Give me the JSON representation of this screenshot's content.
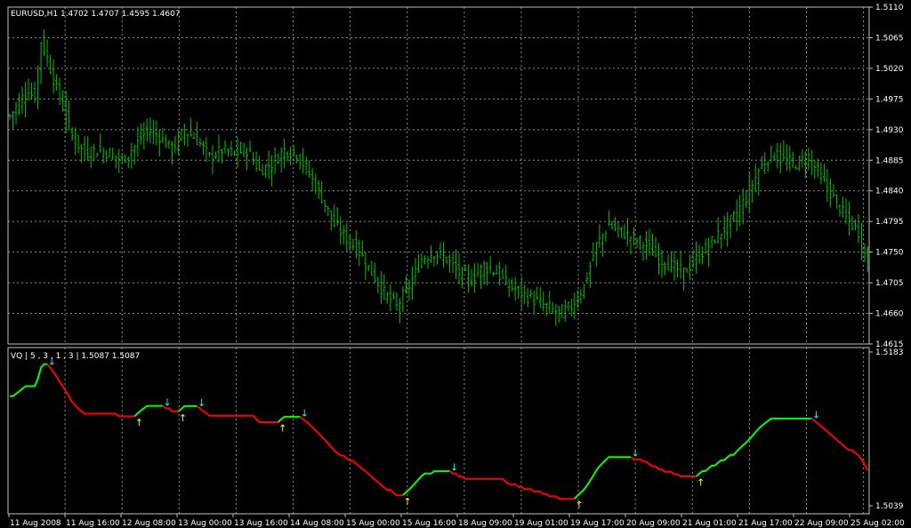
{
  "price_header": "EURUSD,H1  1.4702 1.4707 1.4595 1.4607",
  "indicator_header": "VQ  |  5 , 3 , 1 , 3  |  1.5087 1.5087",
  "colors": {
    "background": "#000000",
    "grid": "#8a8a8a",
    "bars": "#00c000",
    "vq_up": "#00ff00",
    "vq_down": "#ff0000",
    "arrow_up": "#ffff00",
    "arrow_down": "#00ffff",
    "text": "#ffffff"
  },
  "chart_data": [
    {
      "type": "ohlc",
      "title": "EURUSD,H1",
      "ylim": [
        1.4615,
        1.511
      ],
      "y_ticks": [
        "1.5110",
        "1.5065",
        "1.5020",
        "1.4975",
        "1.4930",
        "1.4885",
        "1.4840",
        "1.4795",
        "1.4750",
        "1.4705",
        "1.4660",
        "1.4615"
      ],
      "x_labels": [
        "11 Aug 2008",
        "11 Aug 16:00",
        "12 Aug 08:00",
        "13 Aug 00:00",
        "13 Aug 16:00",
        "14 Aug 08:00",
        "15 Aug 00:00",
        "15 Aug 16:00",
        "18 Aug 09:00",
        "19 Aug 01:00",
        "19 Aug 17:00",
        "20 Aug 09:00",
        "21 Aug 01:00",
        "21 Aug 17:00",
        "22 Aug 09:00",
        "25 Aug 02:00"
      ],
      "close_path": [
        [
          0,
          1.495
        ],
        [
          3,
          1.497
        ],
        [
          5,
          1.4985
        ],
        [
          8,
          1.498
        ],
        [
          10,
          1.506
        ],
        [
          12,
          1.5035
        ],
        [
          15,
          1.499
        ],
        [
          18,
          1.495
        ],
        [
          20,
          1.492
        ],
        [
          24,
          1.4895
        ],
        [
          28,
          1.49
        ],
        [
          32,
          1.4895
        ],
        [
          36,
          1.4885
        ],
        [
          40,
          1.4905
        ],
        [
          44,
          1.493
        ],
        [
          48,
          1.492
        ],
        [
          52,
          1.49
        ],
        [
          56,
          1.493
        ],
        [
          60,
          1.4915
        ],
        [
          64,
          1.489
        ],
        [
          68,
          1.49
        ],
        [
          72,
          1.4895
        ],
        [
          76,
          1.49
        ],
        [
          80,
          1.487
        ],
        [
          84,
          1.488
        ],
        [
          88,
          1.49
        ],
        [
          92,
          1.4895
        ],
        [
          96,
          1.4865
        ],
        [
          100,
          1.483
        ],
        [
          104,
          1.479
        ],
        [
          108,
          1.477
        ],
        [
          112,
          1.475
        ],
        [
          116,
          1.472
        ],
        [
          120,
          1.469
        ],
        [
          124,
          1.467
        ],
        [
          128,
          1.47
        ],
        [
          132,
          1.474
        ],
        [
          136,
          1.475
        ],
        [
          140,
          1.474
        ],
        [
          144,
          1.472
        ],
        [
          148,
          1.471
        ],
        [
          152,
          1.473
        ],
        [
          156,
          1.472
        ],
        [
          160,
          1.47
        ],
        [
          164,
          1.469
        ],
        [
          168,
          1.468
        ],
        [
          172,
          1.467
        ],
        [
          176,
          1.466
        ],
        [
          180,
          1.467
        ],
        [
          184,
          1.47
        ],
        [
          188,
          1.476
        ],
        [
          192,
          1.479
        ],
        [
          196,
          1.478
        ],
        [
          200,
          1.477
        ],
        [
          204,
          1.476
        ],
        [
          208,
          1.474
        ],
        [
          212,
          1.473
        ],
        [
          216,
          1.472
        ],
        [
          220,
          1.474
        ],
        [
          224,
          1.476
        ],
        [
          228,
          1.478
        ],
        [
          232,
          1.48
        ],
        [
          236,
          1.483
        ],
        [
          240,
          1.487
        ],
        [
          244,
          1.4895
        ],
        [
          248,
          1.4885
        ],
        [
          252,
          1.488
        ],
        [
          256,
          1.489
        ],
        [
          260,
          1.486
        ],
        [
          264,
          1.483
        ],
        [
          268,
          1.48
        ],
        [
          272,
          1.478
        ],
        [
          275,
          1.473
        ]
      ]
    },
    {
      "type": "line",
      "title": "VQ",
      "ylim": [
        1.5039,
        1.5183
      ],
      "y_ticks": [
        "1.5183",
        "1.5039"
      ],
      "series": [
        {
          "name": "up",
          "color": "#00ff00"
        },
        {
          "name": "down",
          "color": "#ff0000"
        }
      ]
    }
  ]
}
